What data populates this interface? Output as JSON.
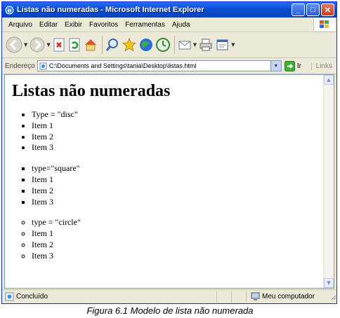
{
  "window": {
    "title": "Listas não numeradas - Microsoft Internet Explorer",
    "minimize": "_",
    "maximize": "□",
    "close": "✕"
  },
  "menu": [
    "Arquivo",
    "Editar",
    "Exibir",
    "Favoritos",
    "Ferramentas",
    "Ajuda"
  ],
  "toolbar": {
    "icons": [
      "back-icon",
      "forward-icon",
      "stop-icon",
      "refresh-icon",
      "home-icon",
      "search-icon",
      "favorites-icon",
      "media-icon",
      "history-icon",
      "mail-icon",
      "print-icon",
      "edit-icon"
    ]
  },
  "address": {
    "label": "Endereço",
    "value": "C:\\Documents and Settings\\tania\\Desktop\\listas.html",
    "go_label": "Ir",
    "links_label": "Links"
  },
  "page": {
    "heading": "Listas não numeradas",
    "lists": [
      {
        "style": "disc",
        "items": [
          "Type = \"disc\"",
          "Item 1",
          "Item 2",
          "Item 3"
        ]
      },
      {
        "style": "square",
        "items": [
          "type=\"square\"",
          "Item 1",
          "Item 2",
          "Item 3"
        ]
      },
      {
        "style": "circle",
        "items": [
          "type = \"circle\"",
          "Item 1",
          "Item 2",
          "Item 3"
        ]
      }
    ]
  },
  "status": {
    "left": "Concluído",
    "zone": "Meu computador"
  },
  "caption": "Figura 6.1 Modelo de lista não numerada",
  "colors": {
    "titlebar": "#0a4fd6",
    "chrome": "#ece9d8",
    "accent_border": "#7f9db9"
  }
}
